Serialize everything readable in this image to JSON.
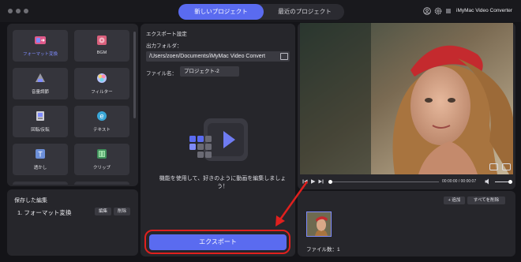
{
  "header": {
    "tabs": [
      {
        "label": "新しいプロジェクト",
        "active": true
      },
      {
        "label": "最近のプロジェクト",
        "active": false
      }
    ],
    "app_title": "iMyMac Video Converter",
    "icons": [
      "user-icon",
      "settings-icon",
      "menu-icon"
    ]
  },
  "tools": [
    {
      "label": "フォーマット変換",
      "icon": "format-convert-icon",
      "active": true
    },
    {
      "label": "BGM",
      "icon": "bgm-icon",
      "active": false
    },
    {
      "label": "音量調節",
      "icon": "volume-adjust-icon",
      "active": false
    },
    {
      "label": "フィルター",
      "icon": "filter-icon",
      "active": false
    },
    {
      "label": "回転/反転",
      "icon": "rotate-flip-icon",
      "active": false
    },
    {
      "label": "テキスト",
      "icon": "text-icon",
      "active": false
    },
    {
      "label": "透かし",
      "icon": "watermark-icon",
      "active": false
    },
    {
      "label": "クリップ",
      "icon": "clip-icon",
      "active": false
    }
  ],
  "saved": {
    "title": "保存した編集",
    "items": [
      {
        "label": "1. フォーマット変換",
        "edit": "編集",
        "delete": "削除"
      }
    ]
  },
  "export": {
    "section_title": "エクスポート設定",
    "folder_label": "出力フォルダ：",
    "folder_path": "/Users/zoen/Documents/iMyMac Video Convert",
    "filename_label": "ファイル名：",
    "filename_value": "プロジェクト-2",
    "hint": "機能を使用して、好きのように動画を編集しましょう！",
    "button": "エクスポート"
  },
  "player": {
    "time": "00:00:00 / 00:00:07"
  },
  "files": {
    "add": "+ 追加",
    "delete_all": "すべてを削除",
    "count": "ファイル数：1"
  },
  "colors": {
    "accent": "#5a6bf0",
    "annotation": "#e0201e"
  }
}
